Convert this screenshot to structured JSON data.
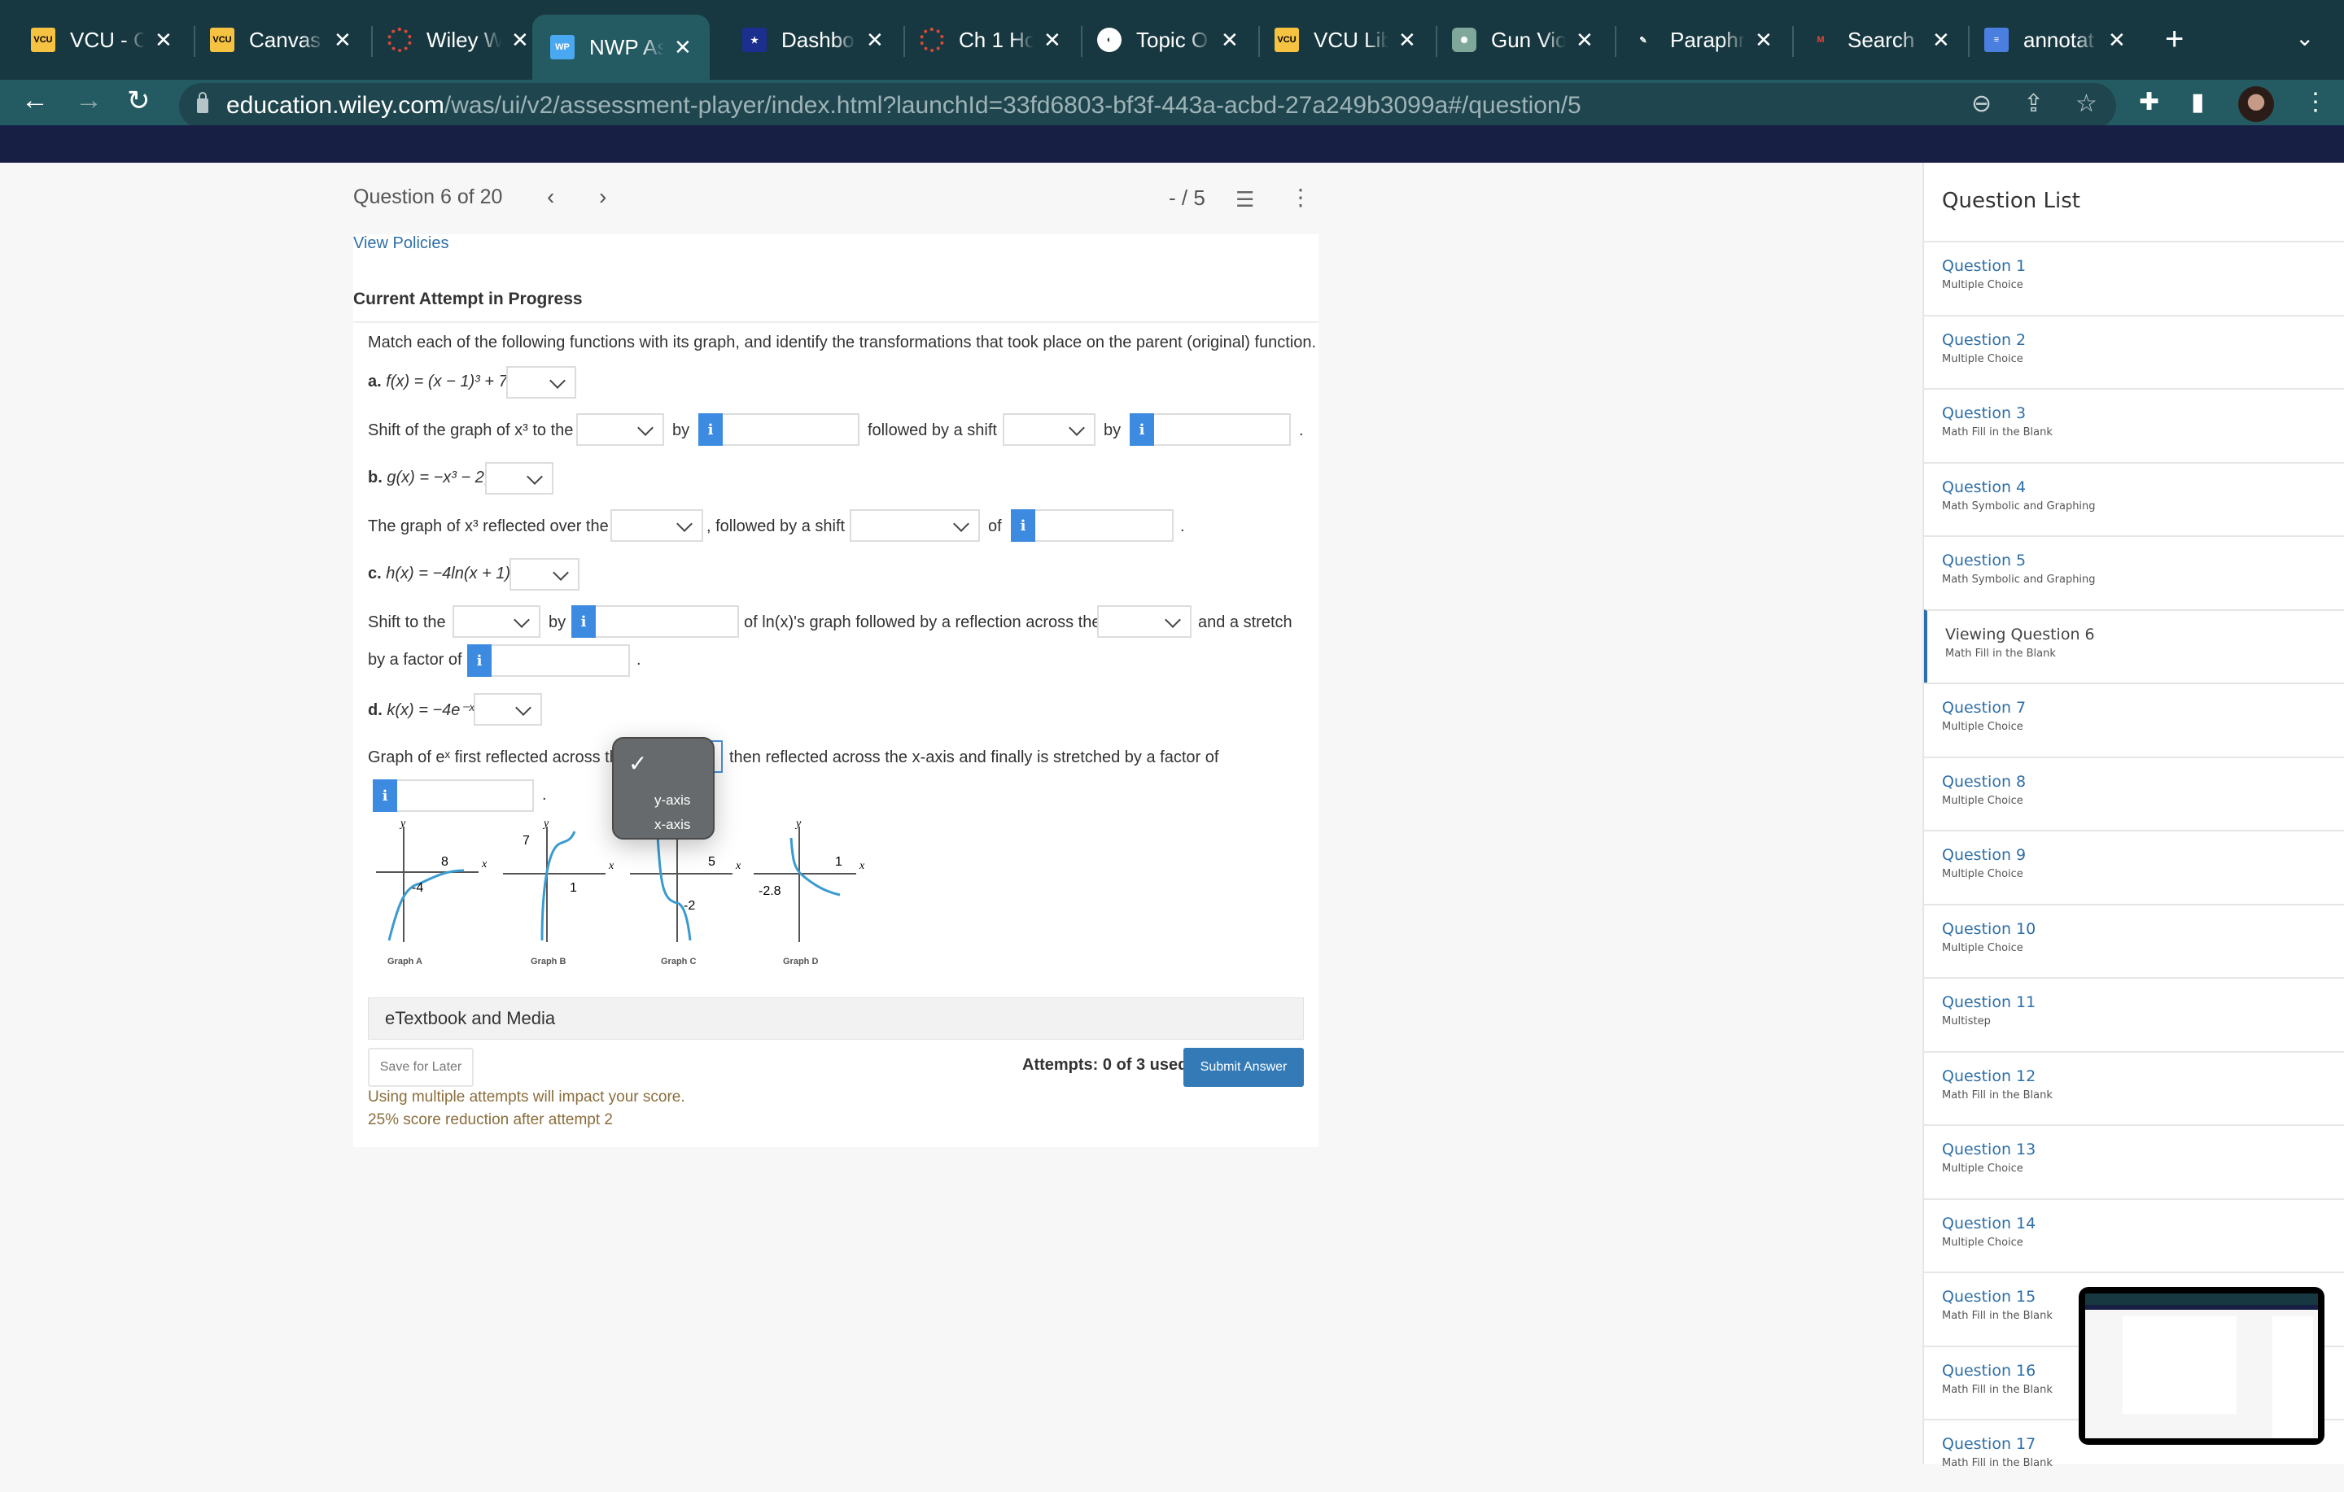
{
  "browser": {
    "tabs": [
      {
        "title": "VCU - C",
        "favicon": "vcu-logo-icon"
      },
      {
        "title": "Canvas",
        "favicon": "vcu-logo-icon"
      },
      {
        "title": "Wiley W",
        "favicon": "canvas-logo-icon"
      },
      {
        "title": "NWP As",
        "favicon": "wp-logo-icon",
        "active": true
      },
      {
        "title": "Dashbo",
        "favicon": "star-badge-icon"
      },
      {
        "title": "Ch 1 Ho",
        "favicon": "canvas-logo-icon"
      },
      {
        "title": "Topic O",
        "favicon": "globe-icon"
      },
      {
        "title": "VCU Lib",
        "favicon": "vcu-logo-icon"
      },
      {
        "title": "Gun Vio",
        "favicon": "chatgpt-icon"
      },
      {
        "title": "Paraphr",
        "favicon": "quill-icon"
      },
      {
        "title": "Search",
        "favicon": "gmail-icon"
      },
      {
        "title": "annotat",
        "favicon": "docs-icon"
      }
    ],
    "favicon_labels": {
      "vcu": "VCU",
      "wp": "WP"
    },
    "url_host": "education.wiley.com",
    "url_path": "/was/ui/v2/assessment-player/index.html?launchId=33fd6803-bf3f-443a-acbd-27a249b3099a#/question/5"
  },
  "header": {
    "question_counter": "Question 6 of 20",
    "score": "- / 5"
  },
  "main": {
    "view_policies": "View Policies",
    "attempt_title": "Current Attempt in Progress",
    "instructions": "Match each of the following functions with its graph, and identify the transformations that took place on the parent (original) function.",
    "parts": {
      "a": {
        "label": "a.",
        "func": "f(x) = (x − 1)³ + 7;",
        "sentence": [
          "Shift of the graph of x³ to the",
          "by",
          "followed by a shift",
          "by",
          "."
        ]
      },
      "b": {
        "label": "b.",
        "func": "g(x) = −x³ − 2;",
        "sentence": [
          "The graph of x³ reflected over the",
          ", followed by a shift",
          "of",
          "."
        ]
      },
      "c": {
        "label": "c.",
        "func": "h(x) = −4ln(x + 1);",
        "sentence": [
          "Shift to the",
          "by",
          "of ln(x)'s graph followed by a reflection across the",
          "and a stretch",
          "by a factor of",
          "."
        ]
      },
      "d": {
        "label": "d.",
        "func": "k(x) = −4e⁻ˣ;",
        "sentence": [
          "Graph of eˣ first reflected across th",
          "then reflected across the x-axis and finally is stretched by a factor of",
          "."
        ]
      }
    },
    "info_label": "i",
    "open_dropdown": {
      "options": [
        "",
        "y-axis",
        "x-axis"
      ],
      "selected": ""
    },
    "graphs": [
      {
        "name": "Graph A",
        "x_label": "x",
        "y_label": "y",
        "marks": [
          "8",
          "-4"
        ]
      },
      {
        "name": "Graph B",
        "x_label": "x",
        "y_label": "y",
        "marks": [
          "7",
          "1"
        ]
      },
      {
        "name": "Graph C",
        "x_label": "x",
        "y_label": "y",
        "marks": [
          "5",
          "-2"
        ]
      },
      {
        "name": "Graph D",
        "x_label": "x",
        "y_label": "y",
        "marks": [
          "1",
          "-2.8"
        ]
      }
    ],
    "etextbook": "eTextbook and Media",
    "save_later": "Save for Later",
    "attempts": "Attempts: 0 of 3 used",
    "submit": "Submit Answer",
    "warning_1": "Using multiple attempts will impact your score.",
    "warning_2": "25% score reduction after attempt 2"
  },
  "sidebar": {
    "title": "Question List",
    "items": [
      {
        "name": "Question 1",
        "type": "Multiple Choice"
      },
      {
        "name": "Question 2",
        "type": "Multiple Choice"
      },
      {
        "name": "Question 3",
        "type": "Math Fill in the Blank"
      },
      {
        "name": "Question 4",
        "type": "Math Symbolic and Graphing"
      },
      {
        "name": "Question 5",
        "type": "Math Symbolic and Graphing"
      },
      {
        "name": "Viewing Question 6",
        "type": "Math Fill in the Blank",
        "active": true
      },
      {
        "name": "Question 7",
        "type": "Multiple Choice"
      },
      {
        "name": "Question 8",
        "type": "Multiple Choice"
      },
      {
        "name": "Question 9",
        "type": "Multiple Choice"
      },
      {
        "name": "Question 10",
        "type": "Multiple Choice"
      },
      {
        "name": "Question 11",
        "type": "Multistep"
      },
      {
        "name": "Question 12",
        "type": "Math Fill in the Blank"
      },
      {
        "name": "Question 13",
        "type": "Multiple Choice"
      },
      {
        "name": "Question 14",
        "type": "Multiple Choice"
      },
      {
        "name": "Question 15",
        "type": "Math Fill in the Blank"
      },
      {
        "name": "Question 16",
        "type": "Math Fill in the Blank"
      },
      {
        "name": "Question 17",
        "type": "Math Fill in the Blank"
      }
    ]
  },
  "colors": {
    "accent": "#337ab7",
    "link": "#2e6fa7",
    "info": "#3d8be0",
    "warning": "#8a6d3b",
    "chrome": "#173840",
    "curve": "#3a9bd0"
  }
}
